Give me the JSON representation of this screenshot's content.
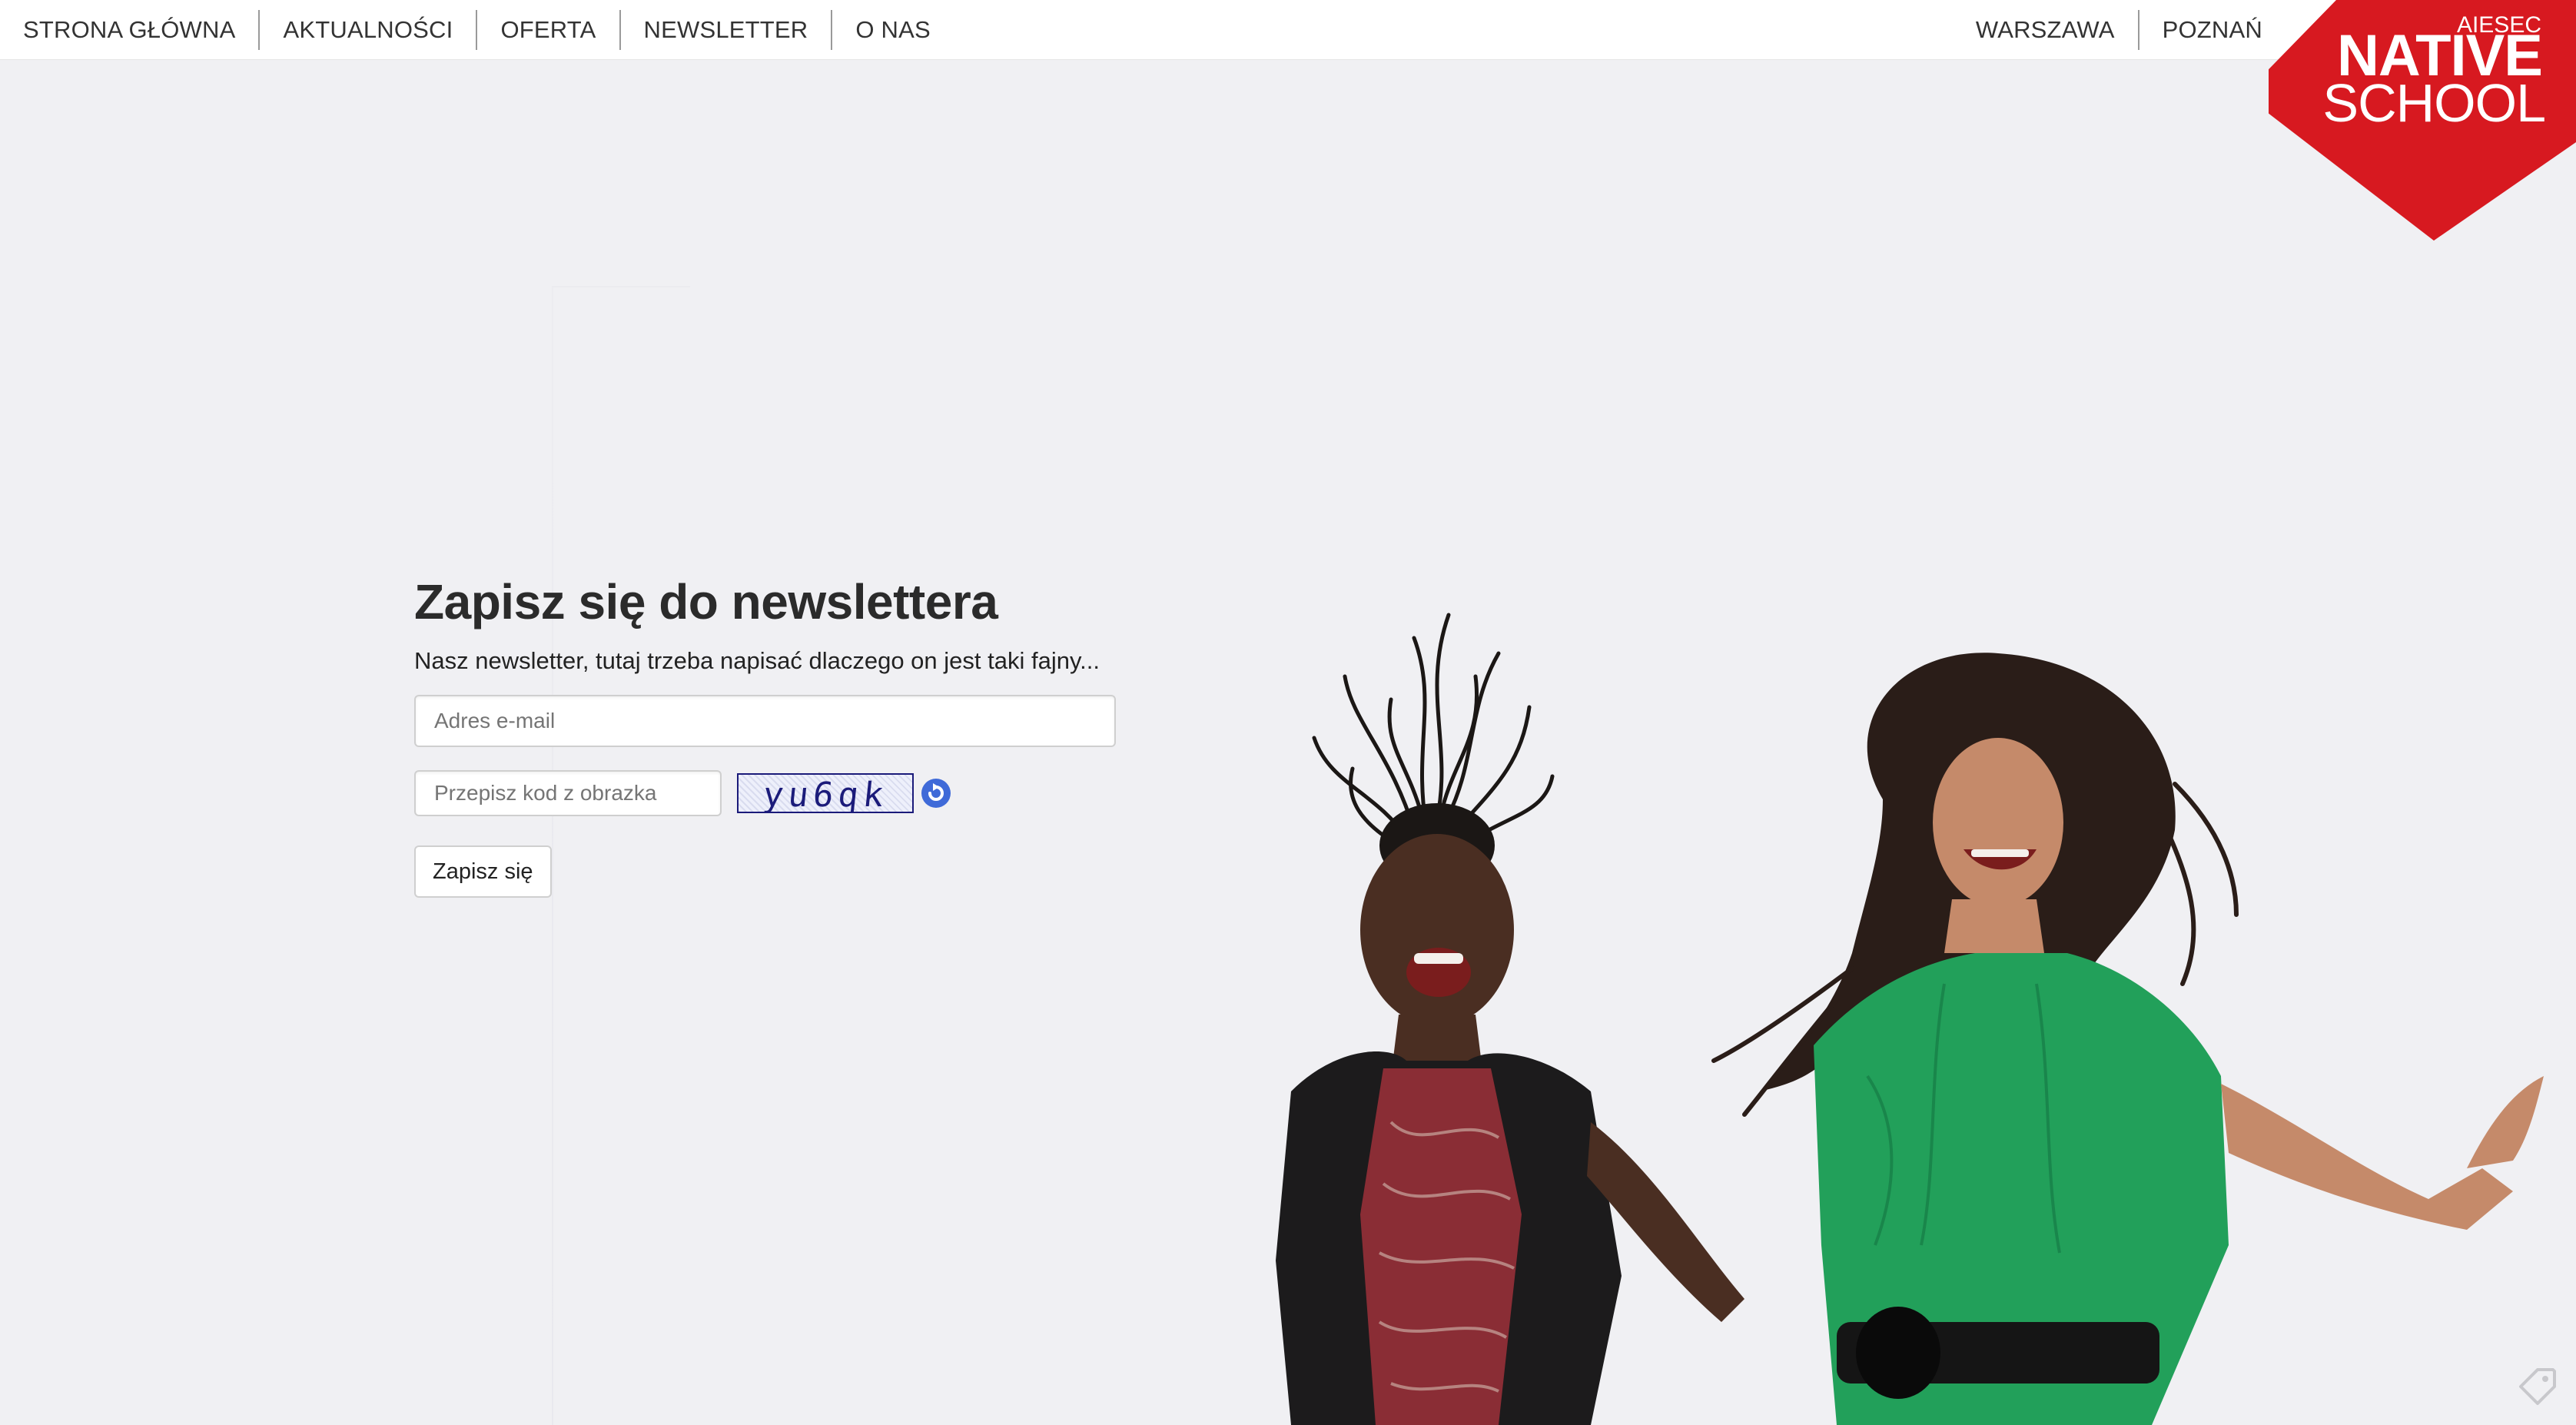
{
  "nav": {
    "left": [
      "STRONA GŁÓWNA",
      "AKTUALNOŚCI",
      "OFERTA",
      "NEWSLETTER",
      "O NAS"
    ],
    "right": [
      "WARSZAWA",
      "POZNAŃ"
    ]
  },
  "logo": {
    "small": "AIESEC",
    "line1": "NATIVE",
    "line2": "SCHOOL",
    "color": "#d71920"
  },
  "newsletter": {
    "title": "Zapisz się do newslettera",
    "description": "Nasz newsletter, tutaj trzeba napisać dlaczego on jest taki fajny...",
    "email_placeholder": "Adres e-mail",
    "captcha_placeholder": "Przepisz kod z obrazka",
    "captcha_code": "yu6qk",
    "submit_label": "Zapisz się"
  },
  "colors": {
    "accent": "#d71920",
    "refresh_icon": "#3f6ad8",
    "background": "#f0f0f3"
  },
  "icons": {
    "refresh": "refresh-icon",
    "corner": "tag-icon"
  }
}
